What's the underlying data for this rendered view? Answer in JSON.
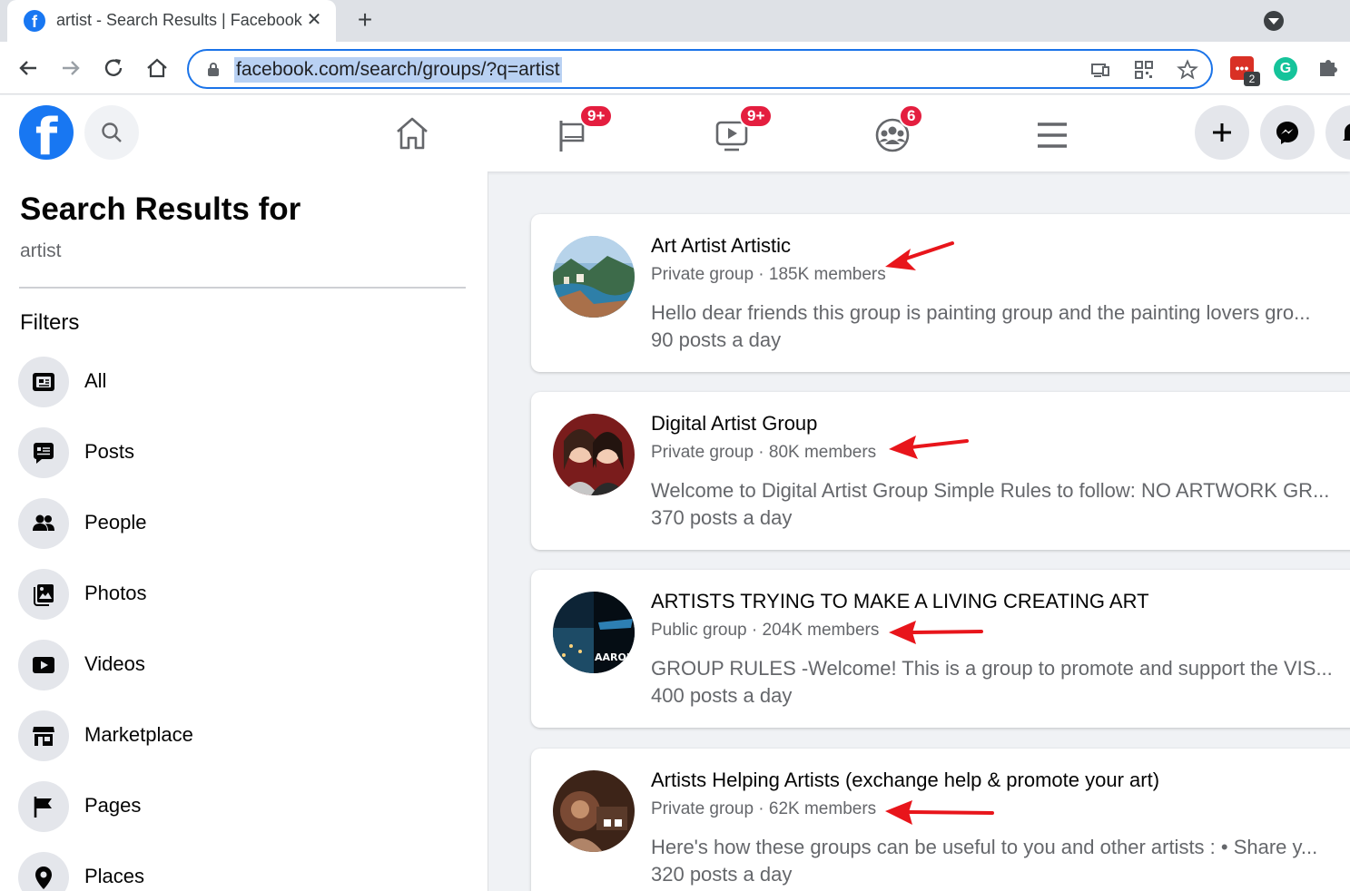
{
  "browser": {
    "tab_title": "artist - Search Results | Facebook",
    "tab_close": "✕",
    "new_tab": "+",
    "url": "facebook.com/search/groups/?q=artist",
    "extension_badge": "2"
  },
  "fb_header": {
    "logo": "f",
    "badges": {
      "pages": "9+",
      "watch": "9+",
      "groups": "6"
    },
    "colors": {
      "brand": "#1877f2",
      "badge": "#e41e3f"
    }
  },
  "left_panel": {
    "title": "Search Results for",
    "query": "artist",
    "filters_heading": "Filters",
    "filters": [
      {
        "label": "All",
        "icon": "feed-icon"
      },
      {
        "label": "Posts",
        "icon": "post-icon"
      },
      {
        "label": "People",
        "icon": "people-icon"
      },
      {
        "label": "Photos",
        "icon": "photos-icon"
      },
      {
        "label": "Videos",
        "icon": "video-icon"
      },
      {
        "label": "Marketplace",
        "icon": "marketplace-icon"
      },
      {
        "label": "Pages",
        "icon": "flag-icon"
      },
      {
        "label": "Places",
        "icon": "location-pin-icon"
      }
    ]
  },
  "results": [
    {
      "name": "Art Artist Artistic",
      "meta": "Private group · 185K members",
      "description": "Hello dear friends this group is painting group and the painting lovers gro...",
      "rate": "90 posts a day"
    },
    {
      "name": "Digital Artist Group",
      "meta": "Private group · 80K members",
      "description": "Welcome to Digital Artist Group Simple Rules to follow: NO ARTWORK GR...",
      "rate": "370 posts a day"
    },
    {
      "name": "ARTISTS TRYING TO MAKE A LIVING CREATING ART",
      "meta": "Public group · 204K members",
      "description": "GROUP RULES -Welcome! This is a group to promote and support the VIS...",
      "rate": "400 posts a day"
    },
    {
      "name": "Artists Helping Artists (exchange help & promote your art)",
      "meta": "Private group · 62K members",
      "description": "Here's how these groups can be useful to you and other artists : • Share y...",
      "rate": "320 posts a day"
    }
  ]
}
